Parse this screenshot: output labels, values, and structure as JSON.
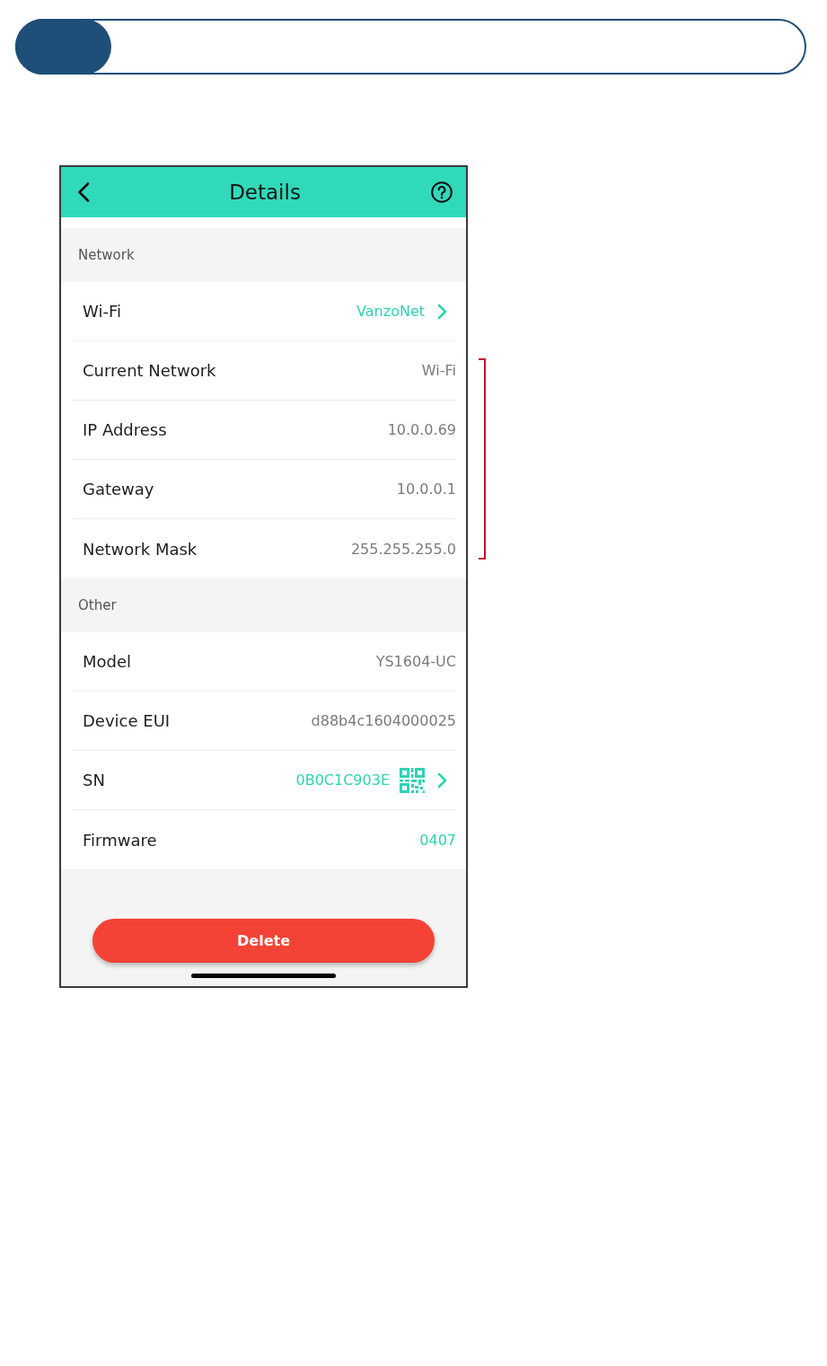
{
  "app_bar": {
    "title": "Details"
  },
  "sections": [
    {
      "title": "Network",
      "rows": [
        {
          "label": "Wi-Fi",
          "value": "VanzoNet",
          "kind": "link"
        },
        {
          "label": "Current Network",
          "value": "Wi-Fi",
          "kind": "plain"
        },
        {
          "label": "IP Address",
          "value": "10.0.0.69",
          "kind": "plain"
        },
        {
          "label": "Gateway",
          "value": "10.0.0.1",
          "kind": "plain"
        },
        {
          "label": "Network Mask",
          "value": "255.255.255.0",
          "kind": "plain"
        }
      ]
    },
    {
      "title": "Other",
      "rows": [
        {
          "label": "Model",
          "value": "YS1604-UC",
          "kind": "plain"
        },
        {
          "label": "Device EUI",
          "value": "d88b4c1604000025",
          "kind": "plain"
        },
        {
          "label": "SN",
          "value": "0B0C1C903E",
          "kind": "qr_link"
        },
        {
          "label": "Firmware",
          "value": "0407",
          "kind": "accent"
        }
      ]
    }
  ],
  "delete_button": {
    "label": "Delete"
  }
}
